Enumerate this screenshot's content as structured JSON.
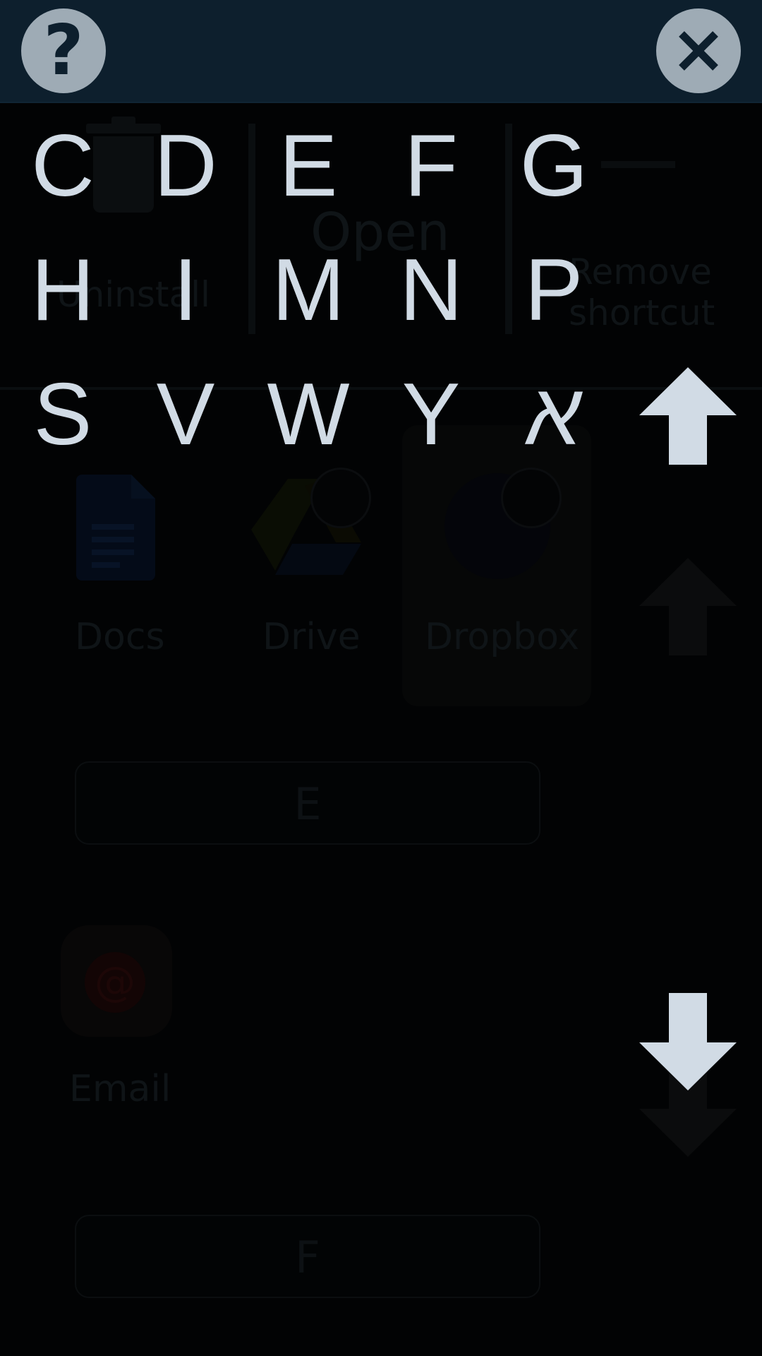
{
  "background": {
    "uninstall_label": "Uninstall",
    "open_label": "Open",
    "remove_shortcut_label": "Remove shortcut",
    "apps": [
      {
        "label": "Docs"
      },
      {
        "label": "Drive"
      },
      {
        "label": "Dropbox"
      },
      {
        "label": "Email"
      }
    ],
    "section_headers": [
      "E",
      "F"
    ]
  },
  "toolbar": {
    "help_icon": "question-mark-icon",
    "help_glyph": "?",
    "close_icon": "close-icon"
  },
  "letters": [
    "C",
    "D",
    "E",
    "F",
    "G",
    "H",
    "I",
    "M",
    "N",
    "P",
    "S",
    "V",
    "W",
    "Y",
    "א"
  ],
  "scroll": {
    "up_icon": "arrow-up-icon",
    "down_icon": "arrow-down-icon"
  },
  "colors": {
    "topbar": "#0d1f2d",
    "button_bg": "#9eabb5",
    "letter_text": "#d1dbe5",
    "overlay": "#020304"
  }
}
